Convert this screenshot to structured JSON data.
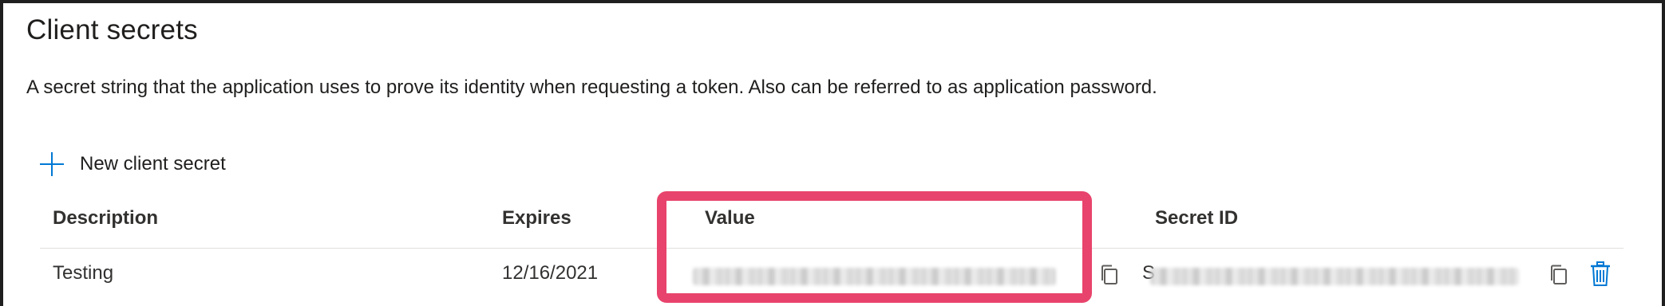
{
  "section": {
    "title": "Client secrets",
    "description": "A secret string that the application uses to prove its identity when requesting a token. Also can be referred to as application password."
  },
  "toolbar": {
    "new_secret_label": "New client secret",
    "new_secret_icon": "plus-icon"
  },
  "table": {
    "columns": [
      "Description",
      "Expires",
      "Value",
      "Secret ID"
    ],
    "rows": [
      {
        "description": "Testing",
        "expires": "12/16/2021",
        "value": "",
        "secret_id_prefix": "S",
        "secret_id": ""
      }
    ]
  },
  "colors": {
    "accent": "#0078d4",
    "highlight": "#e8436c",
    "text": "#323130",
    "divider": "#e1dfdd"
  },
  "icons": {
    "copy": "copy-icon",
    "delete": "trash-icon"
  }
}
